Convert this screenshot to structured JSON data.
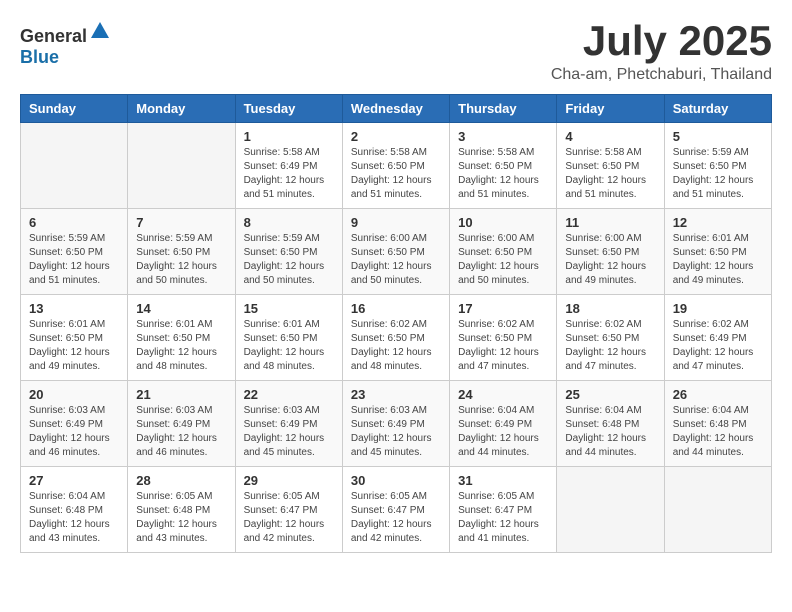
{
  "header": {
    "logo_general": "General",
    "logo_blue": "Blue",
    "month": "July 2025",
    "location": "Cha-am, Phetchaburi, Thailand"
  },
  "weekdays": [
    "Sunday",
    "Monday",
    "Tuesday",
    "Wednesday",
    "Thursday",
    "Friday",
    "Saturday"
  ],
  "weeks": [
    [
      {
        "day": "",
        "info": ""
      },
      {
        "day": "",
        "info": ""
      },
      {
        "day": "1",
        "info": "Sunrise: 5:58 AM\nSunset: 6:49 PM\nDaylight: 12 hours and 51 minutes."
      },
      {
        "day": "2",
        "info": "Sunrise: 5:58 AM\nSunset: 6:50 PM\nDaylight: 12 hours and 51 minutes."
      },
      {
        "day": "3",
        "info": "Sunrise: 5:58 AM\nSunset: 6:50 PM\nDaylight: 12 hours and 51 minutes."
      },
      {
        "day": "4",
        "info": "Sunrise: 5:58 AM\nSunset: 6:50 PM\nDaylight: 12 hours and 51 minutes."
      },
      {
        "day": "5",
        "info": "Sunrise: 5:59 AM\nSunset: 6:50 PM\nDaylight: 12 hours and 51 minutes."
      }
    ],
    [
      {
        "day": "6",
        "info": "Sunrise: 5:59 AM\nSunset: 6:50 PM\nDaylight: 12 hours and 51 minutes."
      },
      {
        "day": "7",
        "info": "Sunrise: 5:59 AM\nSunset: 6:50 PM\nDaylight: 12 hours and 50 minutes."
      },
      {
        "day": "8",
        "info": "Sunrise: 5:59 AM\nSunset: 6:50 PM\nDaylight: 12 hours and 50 minutes."
      },
      {
        "day": "9",
        "info": "Sunrise: 6:00 AM\nSunset: 6:50 PM\nDaylight: 12 hours and 50 minutes."
      },
      {
        "day": "10",
        "info": "Sunrise: 6:00 AM\nSunset: 6:50 PM\nDaylight: 12 hours and 50 minutes."
      },
      {
        "day": "11",
        "info": "Sunrise: 6:00 AM\nSunset: 6:50 PM\nDaylight: 12 hours and 49 minutes."
      },
      {
        "day": "12",
        "info": "Sunrise: 6:01 AM\nSunset: 6:50 PM\nDaylight: 12 hours and 49 minutes."
      }
    ],
    [
      {
        "day": "13",
        "info": "Sunrise: 6:01 AM\nSunset: 6:50 PM\nDaylight: 12 hours and 49 minutes."
      },
      {
        "day": "14",
        "info": "Sunrise: 6:01 AM\nSunset: 6:50 PM\nDaylight: 12 hours and 48 minutes."
      },
      {
        "day": "15",
        "info": "Sunrise: 6:01 AM\nSunset: 6:50 PM\nDaylight: 12 hours and 48 minutes."
      },
      {
        "day": "16",
        "info": "Sunrise: 6:02 AM\nSunset: 6:50 PM\nDaylight: 12 hours and 48 minutes."
      },
      {
        "day": "17",
        "info": "Sunrise: 6:02 AM\nSunset: 6:50 PM\nDaylight: 12 hours and 47 minutes."
      },
      {
        "day": "18",
        "info": "Sunrise: 6:02 AM\nSunset: 6:50 PM\nDaylight: 12 hours and 47 minutes."
      },
      {
        "day": "19",
        "info": "Sunrise: 6:02 AM\nSunset: 6:49 PM\nDaylight: 12 hours and 47 minutes."
      }
    ],
    [
      {
        "day": "20",
        "info": "Sunrise: 6:03 AM\nSunset: 6:49 PM\nDaylight: 12 hours and 46 minutes."
      },
      {
        "day": "21",
        "info": "Sunrise: 6:03 AM\nSunset: 6:49 PM\nDaylight: 12 hours and 46 minutes."
      },
      {
        "day": "22",
        "info": "Sunrise: 6:03 AM\nSunset: 6:49 PM\nDaylight: 12 hours and 45 minutes."
      },
      {
        "day": "23",
        "info": "Sunrise: 6:03 AM\nSunset: 6:49 PM\nDaylight: 12 hours and 45 minutes."
      },
      {
        "day": "24",
        "info": "Sunrise: 6:04 AM\nSunset: 6:49 PM\nDaylight: 12 hours and 44 minutes."
      },
      {
        "day": "25",
        "info": "Sunrise: 6:04 AM\nSunset: 6:48 PM\nDaylight: 12 hours and 44 minutes."
      },
      {
        "day": "26",
        "info": "Sunrise: 6:04 AM\nSunset: 6:48 PM\nDaylight: 12 hours and 44 minutes."
      }
    ],
    [
      {
        "day": "27",
        "info": "Sunrise: 6:04 AM\nSunset: 6:48 PM\nDaylight: 12 hours and 43 minutes."
      },
      {
        "day": "28",
        "info": "Sunrise: 6:05 AM\nSunset: 6:48 PM\nDaylight: 12 hours and 43 minutes."
      },
      {
        "day": "29",
        "info": "Sunrise: 6:05 AM\nSunset: 6:47 PM\nDaylight: 12 hours and 42 minutes."
      },
      {
        "day": "30",
        "info": "Sunrise: 6:05 AM\nSunset: 6:47 PM\nDaylight: 12 hours and 42 minutes."
      },
      {
        "day": "31",
        "info": "Sunrise: 6:05 AM\nSunset: 6:47 PM\nDaylight: 12 hours and 41 minutes."
      },
      {
        "day": "",
        "info": ""
      },
      {
        "day": "",
        "info": ""
      }
    ]
  ]
}
